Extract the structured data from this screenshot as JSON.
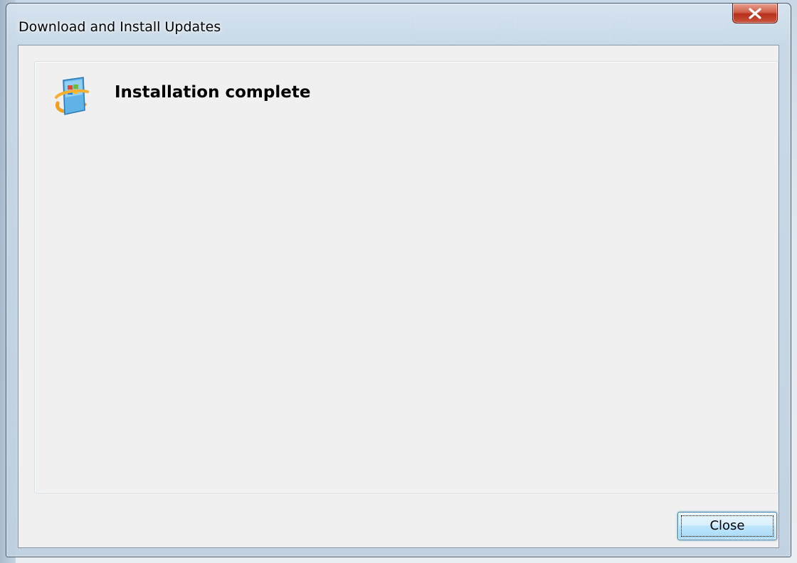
{
  "window": {
    "title": "Download and Install Updates",
    "close_icon": "close-x-icon"
  },
  "main": {
    "icon": "windows-update-icon",
    "heading": "Installation complete"
  },
  "footer": {
    "close_label": "Close"
  },
  "colors": {
    "close_x_red": "#c9402a",
    "button_focus_blue": "#3c7fb1",
    "client_background": "#f0f0f0"
  }
}
